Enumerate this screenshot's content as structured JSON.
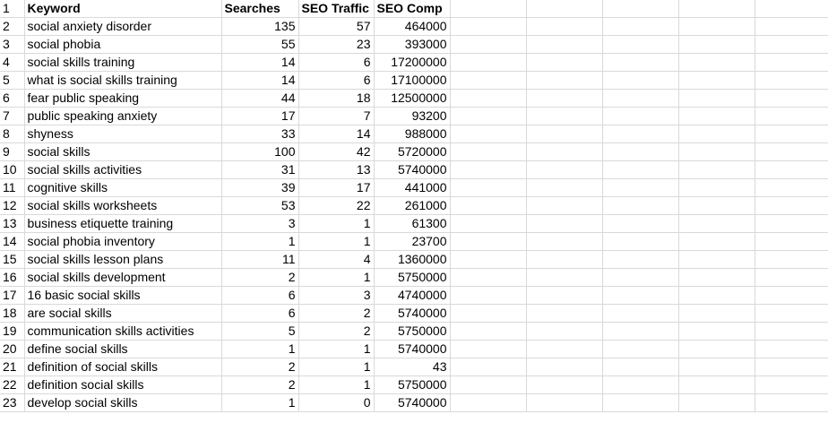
{
  "sheet": {
    "headers": [
      "Keyword",
      "Searches",
      "SEO Traffic",
      "SEO Comp"
    ],
    "rows": [
      [
        "social anxiety disorder",
        "135",
        "57",
        "464000"
      ],
      [
        "social phobia",
        "55",
        "23",
        "393000"
      ],
      [
        "social skills training",
        "14",
        "6",
        "17200000"
      ],
      [
        "what is social skills training",
        "14",
        "6",
        "17100000"
      ],
      [
        "fear public speaking",
        "44",
        "18",
        "12500000"
      ],
      [
        "public speaking anxiety",
        "17",
        "7",
        "93200"
      ],
      [
        "shyness",
        "33",
        "14",
        "988000"
      ],
      [
        "social skills",
        "100",
        "42",
        "5720000"
      ],
      [
        "social skills activities",
        "31",
        "13",
        "5740000"
      ],
      [
        "cognitive skills",
        "39",
        "17",
        "441000"
      ],
      [
        "social skills worksheets",
        "53",
        "22",
        "261000"
      ],
      [
        "business etiquette training",
        "3",
        "1",
        "61300"
      ],
      [
        "social phobia inventory",
        "1",
        "1",
        "23700"
      ],
      [
        "social skills lesson plans",
        "11",
        "4",
        "1360000"
      ],
      [
        "social skills development",
        "2",
        "1",
        "5750000"
      ],
      [
        "16 basic social skills",
        "6",
        "3",
        "4740000"
      ],
      [
        "are social skills",
        "6",
        "2",
        "5740000"
      ],
      [
        "communication skills activities",
        "5",
        "2",
        "5750000"
      ],
      [
        "define social skills",
        "1",
        "1",
        "5740000"
      ],
      [
        "definition of social skills",
        "2",
        "1",
        "43"
      ],
      [
        "definition social skills",
        "2",
        "1",
        "5750000"
      ],
      [
        "develop social skills",
        "1",
        "0",
        "5740000"
      ]
    ]
  }
}
